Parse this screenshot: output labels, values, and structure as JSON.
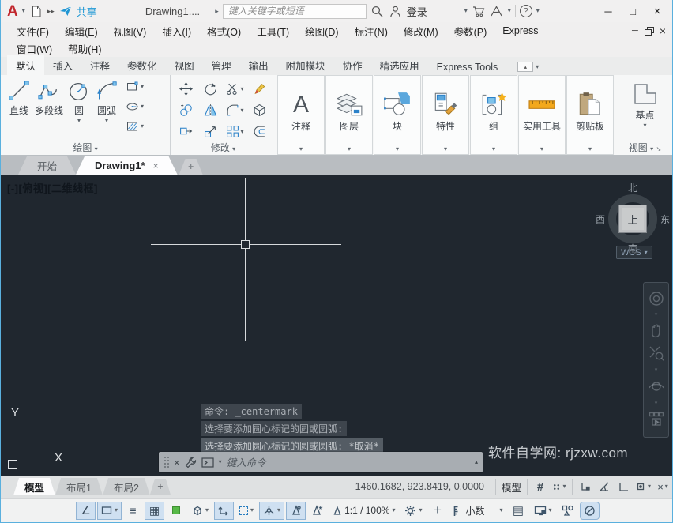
{
  "colors": {
    "accent_blue": "#1e98d5",
    "logo_red": "#c1272d",
    "canvas_bg": "#20272f",
    "toggle_highlight": "#cfe0f1"
  },
  "window": {
    "min": "─",
    "max": "□",
    "close": "×"
  },
  "icons": {
    "cd": "▾",
    "cu": "▴",
    "cr": "▸",
    "play2": "▸▸",
    "q": "?",
    "grid": "#",
    "eq": "≡",
    "checker": "▦",
    "list": "▤",
    "angle": "∠",
    "plus": "+",
    "x": "×",
    "launcher": "↘"
  },
  "titlebar": {
    "logo": "A",
    "share": "共享",
    "title": "Drawing1....",
    "search_placeholder": "键入关键字或短语",
    "login": "登录"
  },
  "menubar": {
    "items": [
      "文件(F)",
      "编辑(E)",
      "视图(V)",
      "插入(I)",
      "格式(O)",
      "工具(T)",
      "绘图(D)",
      "标注(N)",
      "修改(M)",
      "参数(P)",
      "Express"
    ],
    "items2": [
      "窗口(W)",
      "帮助(H)"
    ]
  },
  "ribbon": {
    "tabs": [
      "默认",
      "插入",
      "注释",
      "参数化",
      "视图",
      "管理",
      "输出",
      "附加模块",
      "协作",
      "精选应用",
      "Express Tools"
    ],
    "draw": {
      "label": "绘图",
      "line": "直线",
      "polyline": "多段线",
      "circle": "圆",
      "arc": "圆弧"
    },
    "modify": {
      "label": "修改"
    },
    "annotate_glyph": "A",
    "cards": [
      {
        "label": "注释"
      },
      {
        "label": "图层"
      },
      {
        "label": "块"
      },
      {
        "label": "特性"
      },
      {
        "label": "组"
      },
      {
        "label": "实用工具"
      },
      {
        "label": "剪贴板"
      }
    ],
    "view": {
      "label": "视图",
      "base": "基点"
    }
  },
  "file_tabs": {
    "start": "开始",
    "active": "Drawing1*"
  },
  "canvas": {
    "viewport_label": "[-][俯视][二维线框]",
    "viewcube": {
      "n": "北",
      "s": "南",
      "w": "西",
      "e": "东",
      "top": "上",
      "wcs": "WCS"
    },
    "history": [
      "命令: _centermark",
      "选择要添加圆心标记的圆或圆弧:",
      "选择要添加圆心标记的圆或圆弧: *取消*"
    ],
    "command_placeholder": "键入命令",
    "watermark": "软件自学网: rjzxw.com",
    "ucs": {
      "x": "X",
      "y": "Y"
    }
  },
  "statusbar": {
    "layout_tabs": [
      "模型",
      "布局1",
      "布局2"
    ],
    "coordinates": "1460.1682, 923.8419, 0.0000",
    "model_label": "模型",
    "annotation_scale": "1:1 / 100%",
    "units": "小数"
  }
}
